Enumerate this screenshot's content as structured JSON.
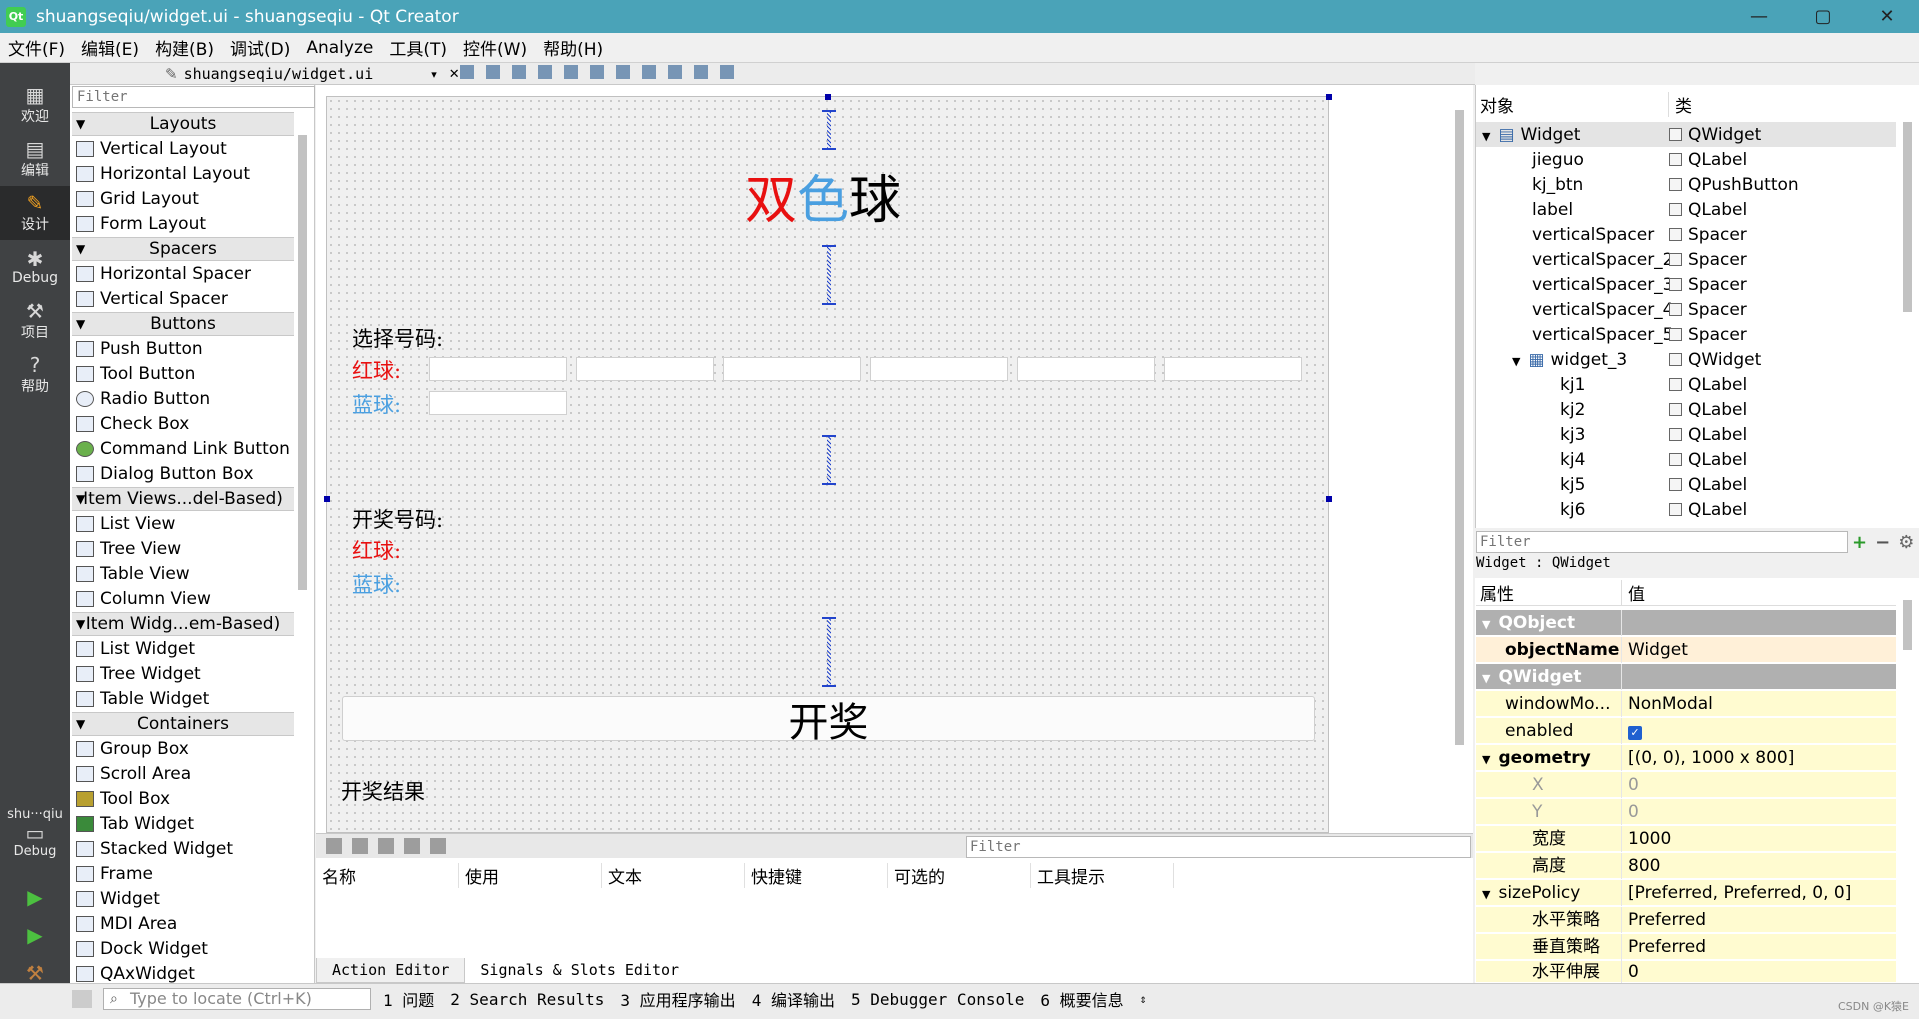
{
  "window": {
    "title": "shuangseqiu/widget.ui - shuangseqiu - Qt Creator",
    "app_icon": "Qt",
    "minimize": "—",
    "maximize": "▢",
    "close": "✕"
  },
  "menu": [
    "文件(F)",
    "编辑(E)",
    "构建(B)",
    "调试(D)",
    "Analyze",
    "工具(T)",
    "控件(W)",
    "帮助(H)"
  ],
  "modes": [
    {
      "label": "欢迎",
      "icon": "grid-icon"
    },
    {
      "label": "编辑",
      "icon": "document-icon"
    },
    {
      "label": "设计",
      "icon": "pencil-icon"
    },
    {
      "label": "Debug",
      "icon": "bug-icon"
    },
    {
      "label": "项目",
      "icon": "wrench-icon"
    },
    {
      "label": "帮助",
      "icon": "help-icon"
    }
  ],
  "kit": {
    "project": "shu···qiu",
    "mode": "Debug"
  },
  "form_tab": {
    "file": "shuangseqiu/widget.ui"
  },
  "widget_box": {
    "filter_placeholder": "Filter",
    "categories": [
      {
        "name": "Layouts",
        "items": [
          "Vertical Layout",
          "Horizontal Layout",
          "Grid Layout",
          "Form Layout"
        ]
      },
      {
        "name": "Spacers",
        "items": [
          "Horizontal Spacer",
          "Vertical Spacer"
        ]
      },
      {
        "name": "Buttons",
        "items": [
          "Push Button",
          "Tool Button",
          "Radio Button",
          "Check Box",
          "Command Link Button",
          "Dialog Button Box"
        ]
      },
      {
        "name": "Item Views...del-Based)",
        "items": [
          "List View",
          "Tree View",
          "Table View",
          "Column View"
        ]
      },
      {
        "name": "Item Widg...em-Based)",
        "items": [
          "List Widget",
          "Tree Widget",
          "Table Widget"
        ]
      },
      {
        "name": "Containers",
        "items": [
          "Group Box",
          "Scroll Area",
          "Tool Box",
          "Tab Widget",
          "Stacked Widget",
          "Frame",
          "Widget",
          "MDI Area",
          "Dock Widget",
          "QAxWidget"
        ]
      }
    ]
  },
  "form": {
    "title": [
      "双",
      "色",
      "球"
    ],
    "select_label": "选择号码:",
    "red_label": "红球:",
    "blue_label": "蓝球:",
    "draw_label": "开奖号码:",
    "draw_red_label": "红球:",
    "draw_blue_label": "蓝球:",
    "button": "开奖",
    "result_label": "开奖结果"
  },
  "action_editor": {
    "filter_placeholder": "Filter",
    "columns": [
      "名称",
      "使用",
      "文本",
      "快捷键",
      "可选的",
      "工具提示"
    ],
    "tabs": [
      "Action Editor",
      "Signals & Slots Editor"
    ]
  },
  "object_inspector": {
    "columns": [
      "对象",
      "类"
    ],
    "rows": [
      {
        "name": "Widget",
        "cls": "QWidget"
      },
      {
        "name": "jieguo",
        "cls": "QLabel"
      },
      {
        "name": "kj_btn",
        "cls": "QPushButton"
      },
      {
        "name": "label",
        "cls": "QLabel"
      },
      {
        "name": "verticalSpacer",
        "cls": "Spacer"
      },
      {
        "name": "verticalSpacer_2",
        "cls": "Spacer"
      },
      {
        "name": "verticalSpacer_3",
        "cls": "Spacer"
      },
      {
        "name": "verticalSpacer_4",
        "cls": "Spacer"
      },
      {
        "name": "verticalSpacer_5",
        "cls": "Spacer"
      },
      {
        "name": "widget_3",
        "cls": "QWidget"
      },
      {
        "name": "kj1",
        "cls": "QLabel"
      },
      {
        "name": "kj2",
        "cls": "QLabel"
      },
      {
        "name": "kj3",
        "cls": "QLabel"
      },
      {
        "name": "kj4",
        "cls": "QLabel"
      },
      {
        "name": "kj5",
        "cls": "QLabel"
      },
      {
        "name": "kj6",
        "cls": "QLabel"
      }
    ]
  },
  "property_editor": {
    "filter_placeholder": "Filter",
    "class_label": "Widget : QWidget",
    "columns": [
      "属性",
      "值"
    ],
    "rows": [
      {
        "k": "QObject",
        "v": ""
      },
      {
        "k": "objectName",
        "v": "Widget"
      },
      {
        "k": "QWidget",
        "v": ""
      },
      {
        "k": "windowMo...",
        "v": "NonModal"
      },
      {
        "k": "enabled",
        "v": "✓"
      },
      {
        "k": "geometry",
        "v": "[(0, 0), 1000 x 800]"
      },
      {
        "k": "X",
        "v": "0"
      },
      {
        "k": "Y",
        "v": "0"
      },
      {
        "k": "宽度",
        "v": "1000"
      },
      {
        "k": "高度",
        "v": "800"
      },
      {
        "k": "sizePolicy",
        "v": "[Preferred, Preferred, 0, 0]"
      },
      {
        "k": "水平策略",
        "v": "Preferred"
      },
      {
        "k": "垂直策略",
        "v": "Preferred"
      },
      {
        "k": "水平伸展",
        "v": "0"
      }
    ]
  },
  "statusbar": {
    "locate_placeholder": "Type to locate (Ctrl+K)",
    "tabs": [
      "1 问题",
      "2 Search Results",
      "3 应用程序输出",
      "4 编译输出",
      "5 Debugger Console",
      "6 概要信息"
    ],
    "watermark": "CSDN @K猿E"
  },
  "colors": {
    "titlebar": "#4aa3b8",
    "modebar": "#404244",
    "red": "#e81010",
    "blue": "#4a9fe0"
  }
}
